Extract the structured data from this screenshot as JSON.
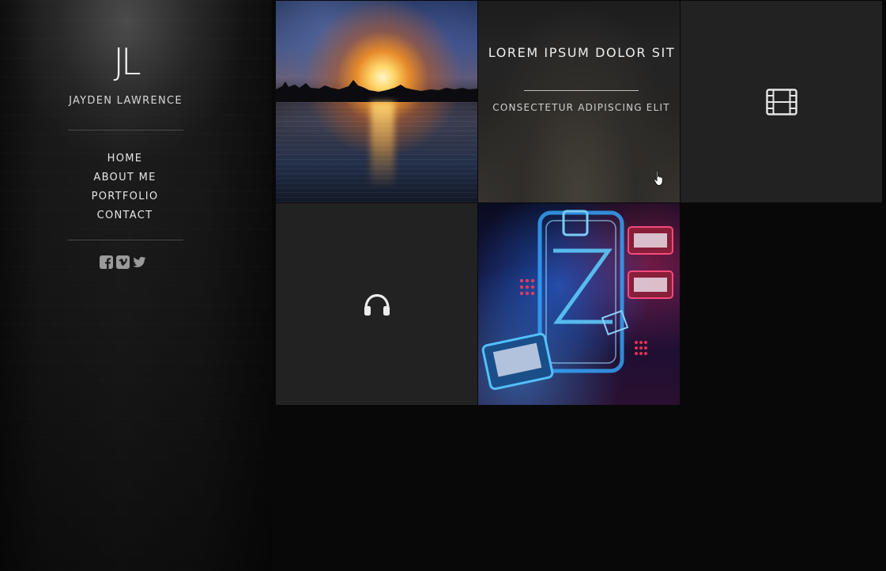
{
  "site": {
    "logo": "JL",
    "owner_name": "JAYDEN LAWRENCE"
  },
  "nav": {
    "items": [
      {
        "label": "HOME"
      },
      {
        "label": "ABOUT ME"
      },
      {
        "label": "PORTFOLIO"
      },
      {
        "label": "CONTACT"
      }
    ]
  },
  "social": {
    "icons": [
      "facebook-icon",
      "vimeo-icon",
      "twitter-icon"
    ]
  },
  "portfolio": {
    "tiles": [
      {
        "type": "image",
        "subject": "sunset-lake"
      },
      {
        "type": "image-hover",
        "subject": "beach",
        "title": "LOREM IPSUM DOLOR SIT",
        "subtitle": "CONSECTETUR ADIPISCING ELIT"
      },
      {
        "type": "icon",
        "icon": "film-icon"
      },
      {
        "type": "icon",
        "icon": "headphones-icon"
      },
      {
        "type": "image",
        "subject": "neon-signs"
      }
    ]
  },
  "colors": {
    "page_background": "#080808",
    "tile_dark": "#222222",
    "text_light": "#e6e6e6"
  }
}
